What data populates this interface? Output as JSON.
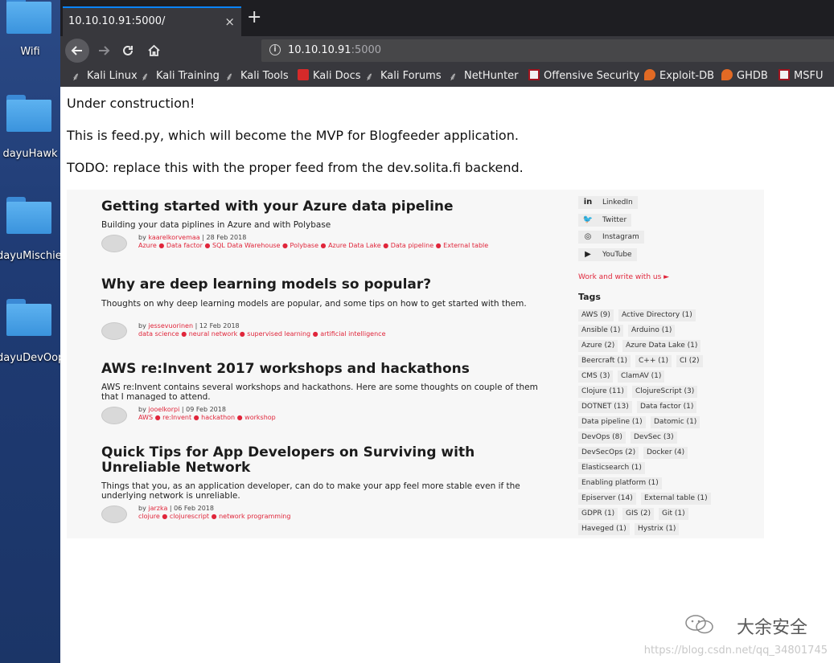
{
  "desktop": {
    "icons": [
      {
        "label": "Wifi"
      },
      {
        "label": "dayuHawk"
      },
      {
        "label": "dayuMischief"
      },
      {
        "label": "dayuDevOops"
      }
    ]
  },
  "browser": {
    "tab_title": "10.10.10.91:5000/",
    "close_symbol": "×",
    "new_tab_symbol": "+",
    "url_host": "10.10.10.91",
    "url_port": ":5000",
    "bookmarks": [
      "Kali Linux",
      "Kali Training",
      "Kali Tools",
      "Kali Docs",
      "Kali Forums",
      "NetHunter",
      "Offensive Security",
      "Exploit-DB",
      "GHDB",
      "MSFU"
    ]
  },
  "page": {
    "line1": "Under construction!",
    "line2": "This is feed.py, which will become the MVP for Blogfeeder application.",
    "line3": "TODO: replace this with the proper feed from the dev.solita.fi backend."
  },
  "blog": {
    "posts": [
      {
        "title": "Getting started with your Azure data pipeline",
        "desc": "Building your data piplines in Azure and with Polybase",
        "author": "kaarelkorvemaa",
        "date": "28 Feb 2018",
        "tags": "Azure ● Data factor ● SQL Data Warehouse ● Polybase ● Azure Data Lake ● Data pipeline ● External table"
      },
      {
        "title": "Why are deep learning models so popular?",
        "desc": "Thoughts on why deep learning models are popular, and some tips on how to get started with them.",
        "author": "jessevuorinen",
        "date": "12 Feb 2018",
        "tags": "data science ● neural network ● supervised learning ● artificial intelligence"
      },
      {
        "title": "AWS re:Invent 2017 workshops and hackathons",
        "desc": "AWS re:Invent contains several workshops and hackathons. Here are some thoughts on couple of them that I managed to attend.",
        "author": "jooelkorpi",
        "date": "09 Feb 2018",
        "tags": "AWS ● re:Invent ● hackathon ● workshop"
      },
      {
        "title": "Quick Tips for App Developers on Surviving with Unreliable Network",
        "desc": "Things that you, as an application developer, can do to make your app feel more stable even if the underlying network is unreliable.",
        "author": "jarzka",
        "date": "06 Feb 2018",
        "tags": "clojure ● clojurescript ● network programming"
      }
    ],
    "by_label": "by",
    "meta_sep": "|",
    "social": [
      {
        "label": "LinkedIn",
        "icon": "in"
      },
      {
        "label": "Twitter",
        "icon": "🐦"
      },
      {
        "label": "Instagram",
        "icon": "◎"
      },
      {
        "label": "YouTube",
        "icon": "▶"
      }
    ],
    "work_link": "Work and write with us  ►",
    "tags_heading": "Tags",
    "tags": [
      [
        "AWS (9)",
        "Active Directory (1)"
      ],
      [
        "Ansible (1)",
        "Arduino (1)"
      ],
      [
        "Azure (2)",
        "Azure Data Lake (1)"
      ],
      [
        "Beercraft (1)",
        "C++ (1)",
        "CI (2)"
      ],
      [
        "CMS (3)",
        "ClamAV (1)"
      ],
      [
        "Clojure (11)",
        "ClojureScript (3)"
      ],
      [
        "DOTNET (13)",
        "Data factor (1)"
      ],
      [
        "Data pipeline (1)",
        "Datomic (1)"
      ],
      [
        "DevOps (8)",
        "DevSec (3)"
      ],
      [
        "DevSecOps (2)",
        "Docker (4)"
      ],
      [
        "Elasticsearch (1)"
      ],
      [
        "Enabling platform (1)"
      ],
      [
        "Episerver (14)",
        "External table (1)"
      ],
      [
        "GDPR (1)",
        "GIS (2)",
        "Git (1)"
      ],
      [
        "Haveged (1)",
        "Hystrix (1)"
      ]
    ]
  },
  "watermark": {
    "cn": "大余安全",
    "url": "https://blog.csdn.net/qq_34801745"
  }
}
